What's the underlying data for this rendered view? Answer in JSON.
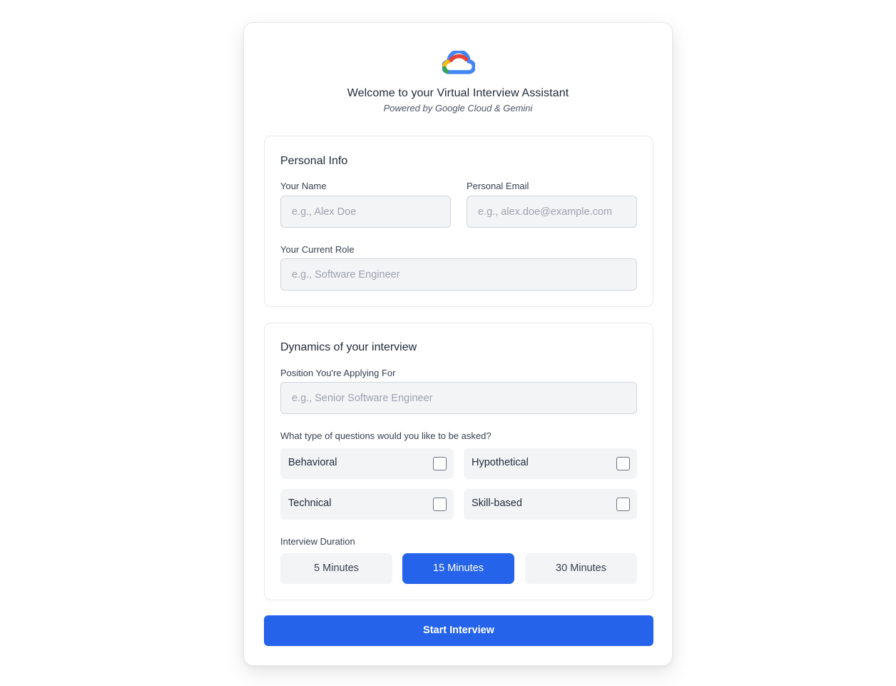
{
  "header": {
    "logo_icon": "google-cloud-logo-icon",
    "title": "Welcome to your Virtual Interview Assistant",
    "subtitle": "Powered by Google Cloud & Gemini"
  },
  "personal_info": {
    "title": "Personal Info",
    "name_label": "Your Name",
    "name_placeholder": "e.g., Alex Doe",
    "name_value": "",
    "email_label": "Personal Email",
    "email_placeholder": "e.g., alex.doe@example.com",
    "email_value": "",
    "role_label": "Your Current Role",
    "role_placeholder": "e.g., Software Engineer",
    "role_value": ""
  },
  "dynamics": {
    "title": "Dynamics of your interview",
    "position_label": "Position You're Applying For",
    "position_placeholder": "e.g., Senior Software Engineer",
    "position_value": "",
    "question_types_label": "What type of questions would you like to be asked?",
    "question_types": [
      {
        "label": "Behavioral",
        "checked": false
      },
      {
        "label": "Hypothetical",
        "checked": false
      },
      {
        "label": "Technical",
        "checked": false
      },
      {
        "label": "Skill-based",
        "checked": false
      }
    ],
    "duration_label": "Interview Duration",
    "durations": [
      {
        "label": "5 Minutes",
        "selected": false
      },
      {
        "label": "15 Minutes",
        "selected": true
      },
      {
        "label": "30 Minutes",
        "selected": false
      }
    ]
  },
  "actions": {
    "start_label": "Start Interview"
  },
  "colors": {
    "accent": "#2563eb",
    "field_bg": "#f3f4f6",
    "border": "#e5e7eb"
  }
}
